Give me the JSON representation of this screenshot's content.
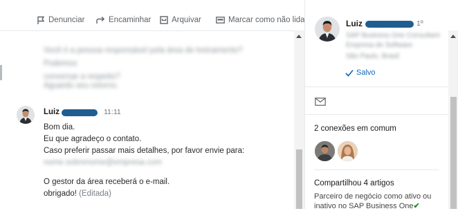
{
  "toolbar": {
    "report_label": "Denunciar",
    "forward_label": "Encaminhar",
    "archive_label": "Arquivar",
    "mark_unread_label": "Marcar como não lida"
  },
  "conversation": {
    "previous_message_lines": [
      "Você é a pessoa responsável pela área de treinamento? Podemos",
      "conversar a respeito?",
      "Aguardo seu retorno."
    ],
    "message": {
      "sender_first_name": "Luiz",
      "time": "11:11",
      "lines": [
        "Bom dia.",
        "Eu que agradeço o contato.",
        "Caso preferir passar mais detalhes, por favor envie para:"
      ],
      "email_redacted": "nome.sobrenome@empresa.com",
      "closing_line": "O gestor da área receberá o e-mail.",
      "signoff": "obrigado!",
      "edited_label": "(Editada)"
    }
  },
  "profile": {
    "first_name": "Luiz",
    "degree": "1º",
    "headline_redacted": [
      "SAP Business One Consultant",
      "Empresa de Software",
      "São Paulo, Brasil"
    ],
    "saved_label": "Salvo",
    "mutual_connections_title": "2 conexões em comum",
    "articles_title": "Compartilhou 4 artigos",
    "article_text": "Parceiro de negócio como ativo ou inativo no SAP Business One"
  },
  "colors": {
    "accent": "#0a66c2",
    "redaction": "#1f5e90",
    "check": "#2e8b2e"
  }
}
